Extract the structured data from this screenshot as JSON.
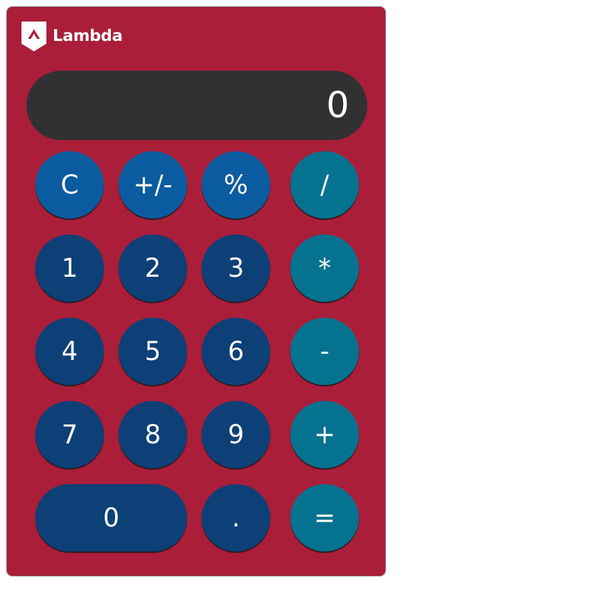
{
  "brand": {
    "name": "Lambda",
    "icon": "lambda-shield-icon"
  },
  "display": {
    "value": "0"
  },
  "buttons": {
    "clear": "C",
    "sign": "+/-",
    "percent": "%",
    "divide": "/",
    "one": "1",
    "two": "2",
    "three": "3",
    "multiply": "*",
    "four": "4",
    "five": "5",
    "six": "6",
    "subtract": "-",
    "seven": "7",
    "eight": "8",
    "nine": "9",
    "add": "+",
    "zero": "0",
    "decimal": ".",
    "equals": "="
  },
  "colors": {
    "body": "#ab1e3a",
    "display": "#313133",
    "function_keys": "#0b5c9e",
    "number_keys": "#0c4077",
    "operator_keys": "#05738f",
    "text": "#ffffff"
  }
}
